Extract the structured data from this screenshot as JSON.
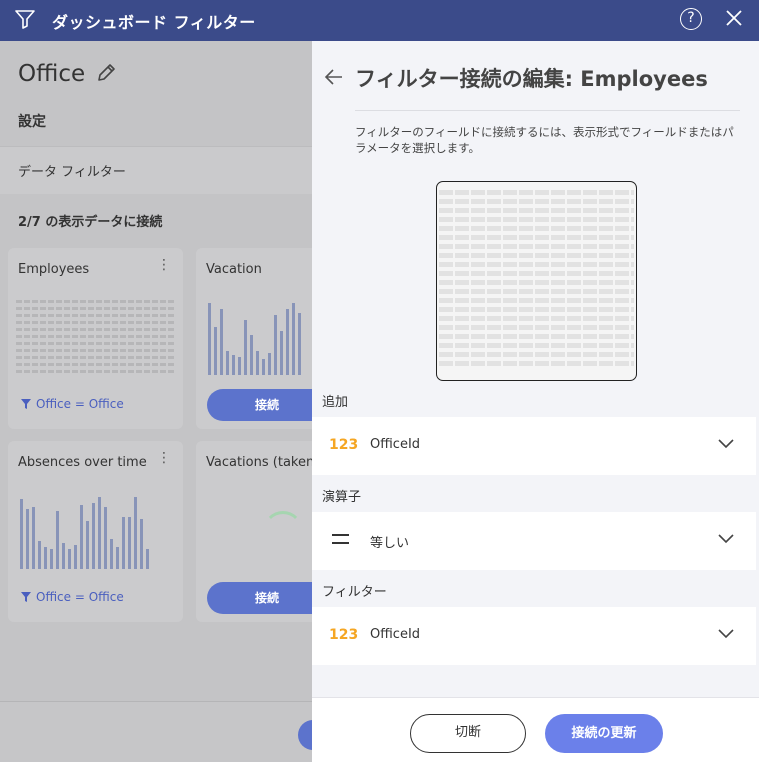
{
  "window": {
    "title": "ダッシュボード フィルター",
    "help_label": "?"
  },
  "left": {
    "office_title": "Office",
    "settings_label": "設定",
    "data_filter_label": "データ フィルター",
    "connected_label": "2/7 の表示データに接続",
    "cards": [
      {
        "title": "Employees",
        "filter": "Office = Office"
      },
      {
        "title": "Vacation",
        "button": "接続"
      },
      {
        "title": "Absences over time",
        "filter": "Office = Office"
      },
      {
        "title": "Vacations (taken",
        "button": "接続"
      }
    ]
  },
  "panel": {
    "title": "フィルター接続の編集: Employees",
    "description": "フィルターのフィールドに接続するには、表示形式でフィールドまたはパラメータを選択します。",
    "add_label": "追加",
    "add_type": "123",
    "add_value": "OfficeId",
    "operator_label": "演算子",
    "operator_value": "等しい",
    "filter_label": "フィルター",
    "filter_type": "123",
    "filter_value": "OfficeId",
    "disconnect_button": "切断",
    "update_button": "接続の更新"
  },
  "colors": {
    "titlebar": "#3b4b8a",
    "accent": "#6b80ea",
    "type_badge": "#f5a623"
  },
  "icons": [
    "filter-icon",
    "help-icon",
    "close-icon",
    "pencil-icon",
    "more-icon",
    "back-arrow-icon",
    "chevron-down-icon",
    "equals-icon"
  ]
}
